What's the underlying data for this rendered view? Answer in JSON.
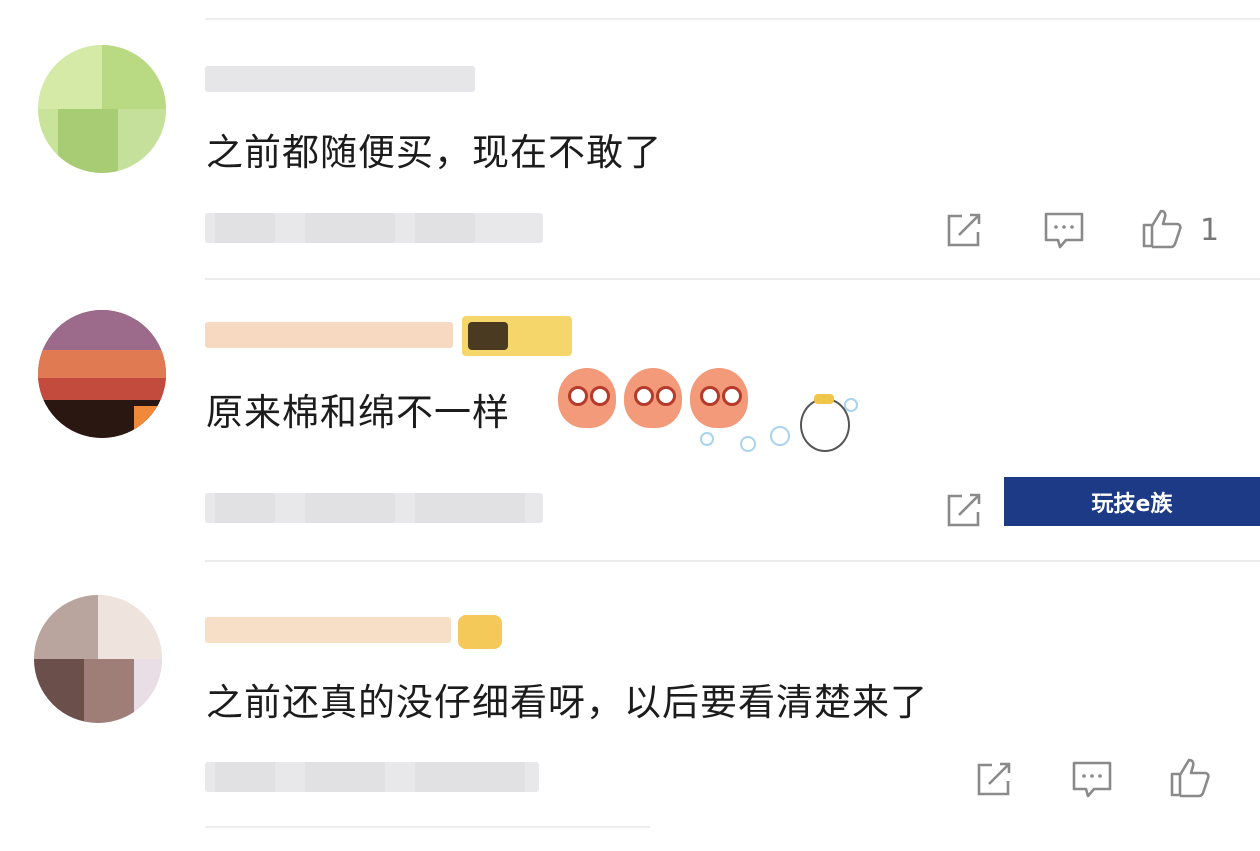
{
  "comments": [
    {
      "text": "之前都随便买，现在不敢了",
      "like_count": "1"
    },
    {
      "text": "原来棉和绵不一样"
    },
    {
      "text": "之前还真的没仔细看呀，以后要看清楚来了"
    }
  ],
  "watermark": {
    "label": "玩技e族"
  },
  "icons": [
    "share-icon",
    "reply-icon",
    "like-icon"
  ]
}
